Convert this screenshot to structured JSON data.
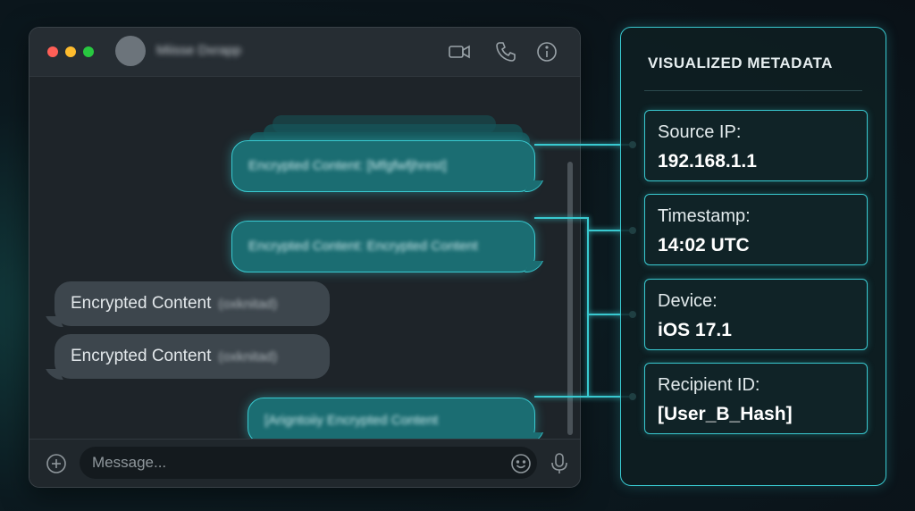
{
  "chat": {
    "contact_name": "Miisse Dxrapp",
    "messages": [
      {
        "direction": "out",
        "text": "Encrypted Content: [Mfgfwfjhrest]"
      },
      {
        "direction": "out",
        "text": "Encrypted Content: Encrypted Content"
      },
      {
        "direction": "in",
        "text": "Encrypted Content",
        "obscured": "(oxknitad)"
      },
      {
        "direction": "in",
        "text": "Encrypted Content",
        "obscured": "(oxknitad)"
      },
      {
        "direction": "out",
        "text": "[Arigntoiiy Encrypted Content"
      }
    ],
    "composer": {
      "placeholder": "Message..."
    },
    "icons": [
      "video-icon",
      "phone-icon",
      "info-icon",
      "add-icon",
      "emoji-icon",
      "microphone-icon"
    ]
  },
  "metadata": {
    "title": "VISUALIZED METADATA",
    "items": [
      {
        "label": "Source IP:",
        "value": "192.168.1.1"
      },
      {
        "label": "Timestamp:",
        "value": "14:02 UTC"
      },
      {
        "label": "Device:",
        "value": "iOS 17.1"
      },
      {
        "label": "Recipient ID:",
        "value": "[User_B_Hash]"
      }
    ]
  },
  "colors": {
    "accent": "#39c9d0",
    "outgoing_bubble": "#1b6d72",
    "incoming_bubble": "#3d464d",
    "window_bg": "#1e2429"
  }
}
